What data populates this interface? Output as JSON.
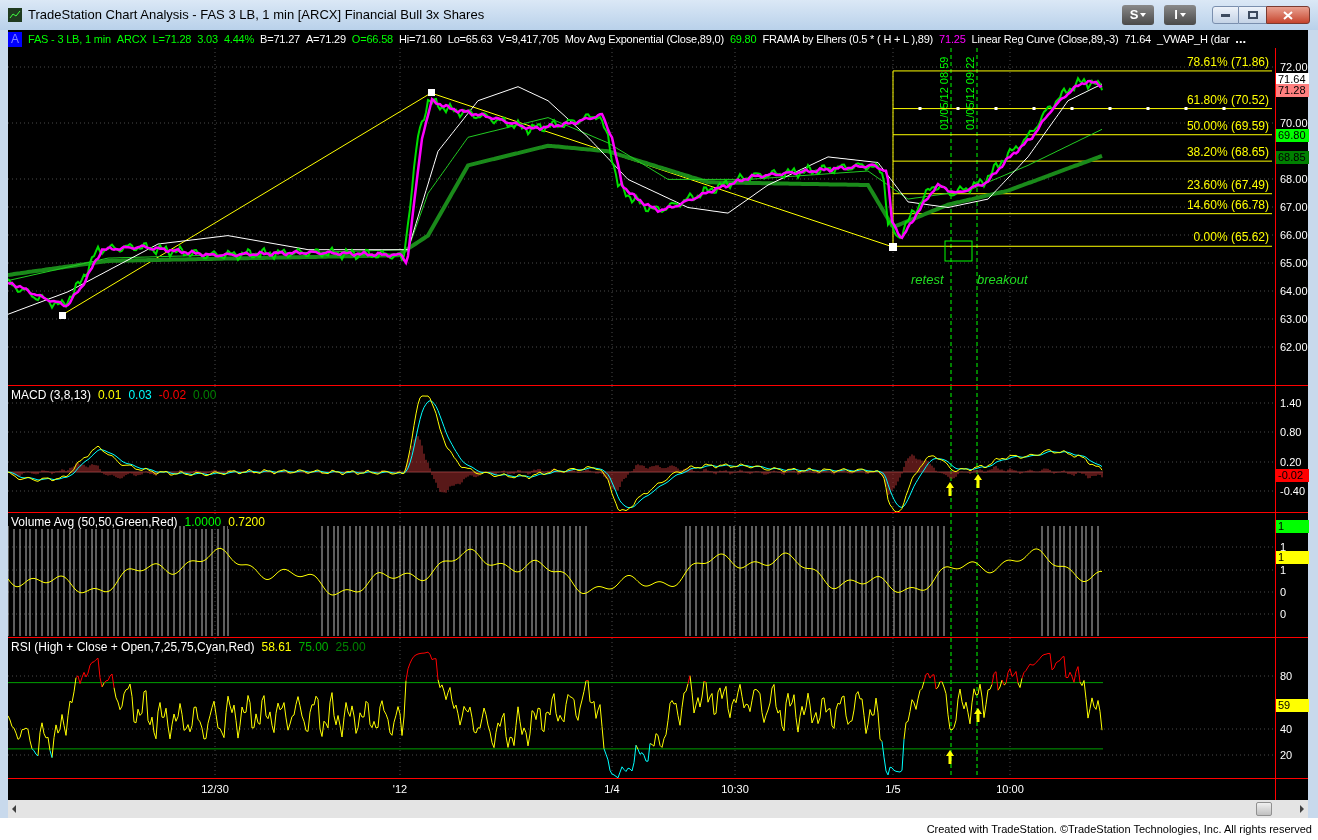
{
  "window": {
    "title": "TradeStation Chart Analysis - FAS 3 LB, 1 min [ARCX] Financial Bull 3x Shares",
    "menu_buttons": [
      "S",
      "I"
    ]
  },
  "status_line": {
    "badge": "A",
    "items": [
      {
        "text": "FAS - 3 LB, 1 min",
        "color": "#00ff00"
      },
      {
        "text": "ARCX",
        "color": "#00ff00"
      },
      {
        "text": "L=71.28",
        "color": "#00ff00"
      },
      {
        "text": "3.03",
        "color": "#00ff00"
      },
      {
        "text": "4.44%",
        "color": "#00ff00"
      },
      {
        "text": "B=71.27",
        "color": "#ffffff"
      },
      {
        "text": "A=71.29",
        "color": "#ffffff"
      },
      {
        "text": "O=66.58",
        "color": "#00ff00"
      },
      {
        "text": "Hi=71.60",
        "color": "#ffffff"
      },
      {
        "text": "Lo=65.63",
        "color": "#ffffff"
      },
      {
        "text": "V=9,417,705",
        "color": "#ffffff"
      },
      {
        "text": "Mov Avg Exponential (Close,89,0)",
        "color": "#ffffff"
      },
      {
        "text": "69.80",
        "color": "#00ff00"
      },
      {
        "text": "FRAMA by Elhers (0.5 * ( H + L ),89)",
        "color": "#ffffff"
      },
      {
        "text": "71.25",
        "color": "#ff00ff"
      },
      {
        "text": "Linear Reg Curve (Close,89,-3)",
        "color": "#ffffff"
      },
      {
        "text": "71.64",
        "color": "#ffffff"
      },
      {
        "text": "_VWAP_H (dar",
        "color": "#ffffff"
      },
      {
        "text": "...",
        "color": "#ffffff"
      }
    ]
  },
  "price_panel": {
    "axis_labels": [
      "72.00",
      "70.00",
      "68.00",
      "67.00",
      "66.00",
      "65.00",
      "64.00",
      "63.00",
      "62.00"
    ],
    "price_tags": [
      {
        "text": "71.64",
        "color": "#ffffff"
      },
      {
        "text": "71.28",
        "color": "#ff8080"
      },
      {
        "text": "69.80",
        "color": "#00ff00"
      },
      {
        "text": "68.85",
        "color": "#008000"
      }
    ],
    "fib_levels": [
      "78.61% (71.86)",
      "61.80% (70.52)",
      "50.00% (69.59)",
      "38.20% (68.65)",
      "23.60% (67.49)",
      "14.60% (66.78)",
      "0.00% (65.62)"
    ],
    "time_markers": [
      "01/05/12 08:59",
      "01/05/12 09:22"
    ],
    "annotations": [
      "retest",
      "breakout"
    ]
  },
  "indicator_panels": [
    {
      "kind": "macd",
      "legend": [
        {
          "text": "MACD (3,8,13)",
          "color": "#ffffff"
        },
        {
          "text": "0.01",
          "color": "#ffff00"
        },
        {
          "text": "0.03",
          "color": "#00ffff"
        },
        {
          "text": "-0.02",
          "color": "#ff0000"
        },
        {
          "text": "0.00",
          "color": "#008000"
        }
      ],
      "axis_labels": [
        "1.40",
        "0.80",
        "0.20",
        "-0.40"
      ],
      "tags": [
        {
          "text": "-0.02",
          "color": "#ff0000"
        }
      ]
    },
    {
      "kind": "volume",
      "legend": [
        {
          "text": "Volume Avg (50,50,Green,Red)",
          "color": "#ffffff"
        },
        {
          "text": "1.0000",
          "color": "#00ff00"
        },
        {
          "text": "0.7200",
          "color": "#ffff00"
        }
      ],
      "axis_labels": [
        "1",
        "1",
        "0",
        "0"
      ],
      "tags": [
        {
          "text": "1",
          "color": "#00ff00"
        },
        {
          "text": "1",
          "color": "#ffff00"
        }
      ]
    },
    {
      "kind": "rsi",
      "legend": [
        {
          "text": "RSI (High + Close + Open,7,25,75,Cyan,Red)",
          "color": "#ffffff"
        },
        {
          "text": "58.61",
          "color": "#ffff00"
        },
        {
          "text": "75.00",
          "color": "#00b000"
        },
        {
          "text": "25.00",
          "color": "#008000"
        }
      ],
      "axis_labels": [
        "80",
        "40",
        "20"
      ],
      "tags": [
        {
          "text": "59",
          "color": "#ffff00"
        }
      ]
    }
  ],
  "x_axis": [
    "12/30",
    "'12",
    "1/4",
    "10:30",
    "1/5",
    "10:00"
  ],
  "footer": "Created with TradeStation. ©TradeStation Technologies, Inc. All rights reserved"
}
